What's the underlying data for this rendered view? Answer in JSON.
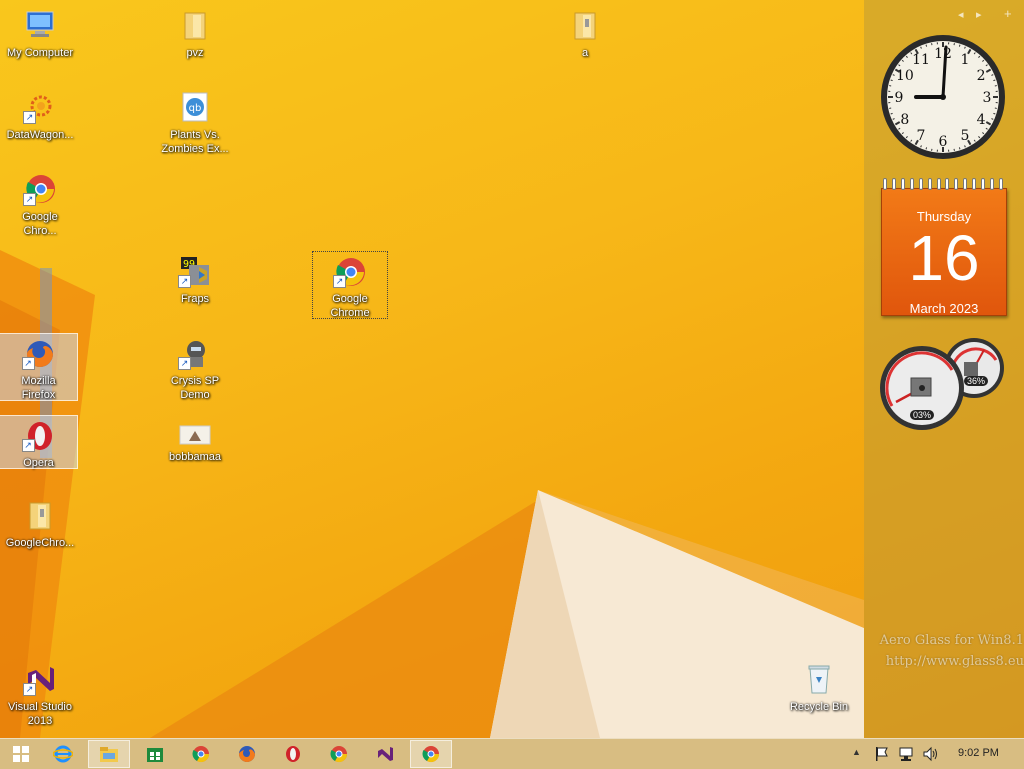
{
  "desktop": {
    "icons": [
      {
        "label": "My Computer"
      },
      {
        "label": "DataWagon..."
      },
      {
        "label": "Google\nChro..."
      },
      {
        "label": "Mozilla\nFirefox"
      },
      {
        "label": "Opera"
      },
      {
        "label": "GoogleChro..."
      },
      {
        "label": "Visual Studio\n2013"
      },
      {
        "label": "pvz"
      },
      {
        "label": "Plants Vs.\nZombies Ex..."
      },
      {
        "label": "Fraps"
      },
      {
        "label": "Crysis SP\nDemo"
      },
      {
        "label": "bobbamaa"
      },
      {
        "label": "Google\nChrome"
      },
      {
        "label": "a"
      },
      {
        "label": "Recycle Bin"
      }
    ]
  },
  "gadgets": {
    "nav_prev": "◂",
    "nav_next": "▸",
    "add": "+",
    "clock_numbers": [
      "12",
      "1",
      "2",
      "3",
      "4",
      "5",
      "6",
      "7",
      "8",
      "9",
      "10",
      "11"
    ],
    "calendar": {
      "day_name": "Thursday",
      "day": "16",
      "month_year": "March 2023"
    },
    "meters": {
      "cpu": "03%",
      "memory": "36%"
    }
  },
  "watermark": {
    "line1": "Aero Glass for Win8.1",
    "line2": "http://www.glass8.eu"
  },
  "taskbar": {
    "apps": [
      "start-icon",
      "internet-explorer-icon",
      "file-explorer-icon",
      "store-icon",
      "chrome-icon",
      "firefox-icon",
      "opera-icon",
      "chrome-icon",
      "visual-studio-icon",
      "chrome-icon"
    ],
    "time": "9:02 PM"
  },
  "colors": {
    "wallpaper": "#f7b718",
    "calendar": "#e8620f",
    "taskbar": "#d2be96"
  }
}
